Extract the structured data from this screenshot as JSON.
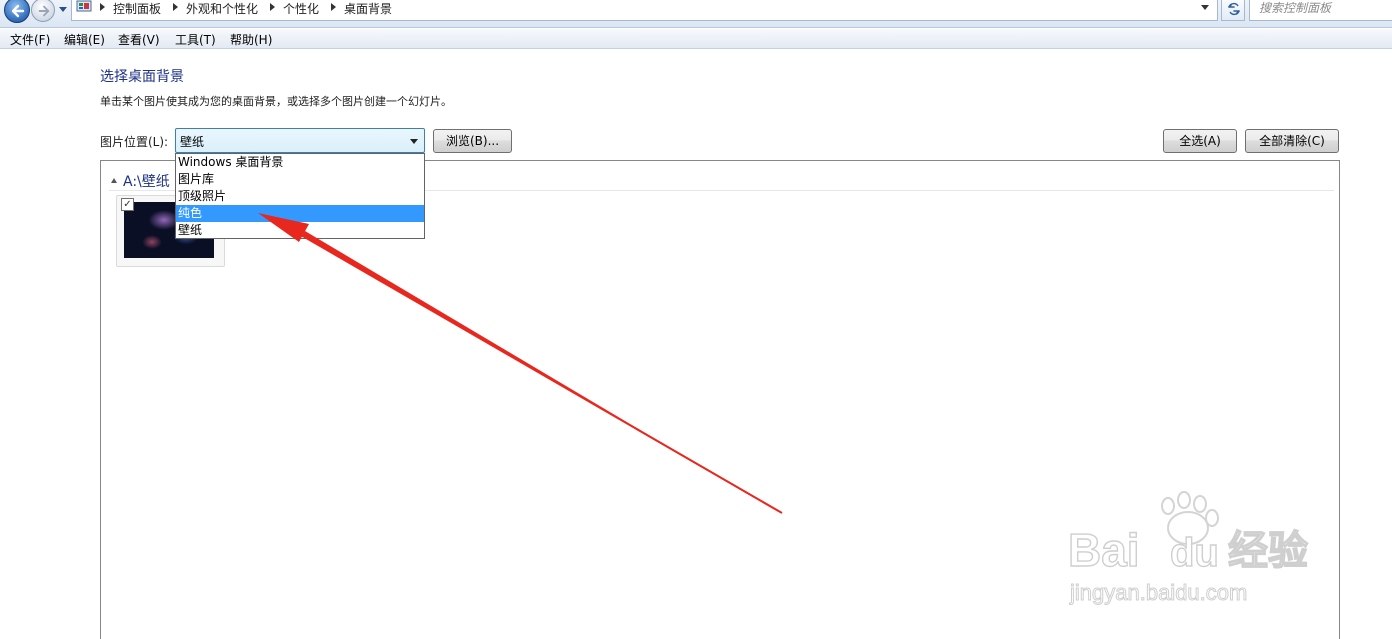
{
  "address_bar": {
    "breadcrumbs": [
      "控制面板",
      "外观和个性化",
      "个性化",
      "桌面背景"
    ],
    "search_placeholder": "搜索控制面板"
  },
  "menu": {
    "items": [
      "文件(F)",
      "编辑(E)",
      "查看(V)",
      "工具(T)",
      "帮助(H)"
    ]
  },
  "content": {
    "title": "选择桌面背景",
    "description": "单击某个图片使其成为您的桌面背景，或选择多个图片创建一个幻灯片。",
    "location_label": "图片位置(L):",
    "location_value": "壁纸",
    "browse_label": "浏览(B)...",
    "select_all_label": "全选(A)",
    "clear_all_label": "全部清除(C)"
  },
  "dropdown": {
    "options": [
      "Windows 桌面背景",
      "图片库",
      "顶级照片",
      "纯色",
      "壁纸"
    ],
    "highlighted": "纯色"
  },
  "gallery": {
    "group_title": "A:\\壁纸",
    "thumbnail_checked": "✓"
  },
  "watermark": {
    "brand_bai": "Bai",
    "brand_du": "du",
    "brand_suffix": "经验",
    "url": "jingyan.baidu.com"
  },
  "colors": {
    "accent_title": "#1e3287",
    "dropdown_highlight": "#3399ff",
    "annotation_arrow": "#e8271f"
  },
  "icons": [
    "back-arrow-icon",
    "forward-arrow-icon",
    "history-dropdown-icon",
    "control-panel-icon",
    "breadcrumb-separator-icon",
    "refresh-icon",
    "combo-arrow-icon",
    "group-collapse-icon",
    "checkbox-icon",
    "paw-icon"
  ]
}
